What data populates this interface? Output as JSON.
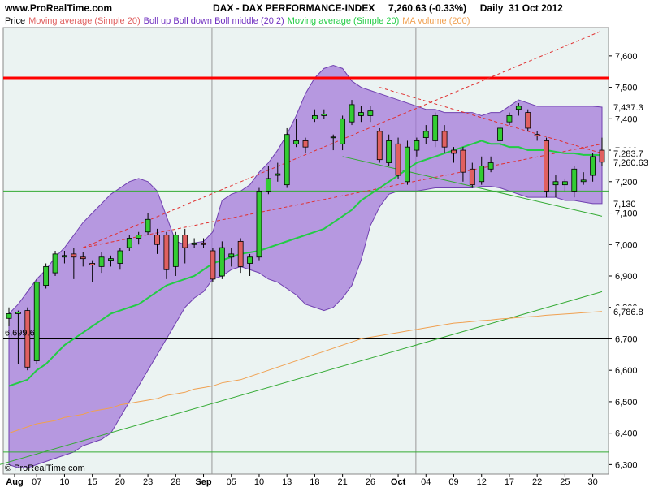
{
  "header": {
    "site": "www.ProRealTime.com",
    "title": "DAX - DAX PERFORMANCE-INDEX     7,260.63 (-0.33%)     Daily  31 Oct 2012"
  },
  "legend": {
    "price": "Price",
    "ma20": "Moving average (Simple 20)",
    "boll": "Boll up Boll down Boll middle (20 2)",
    "ma20_green": "Moving average (Simple 20)",
    "ma200": "MA volume (200)"
  },
  "credit": "© ProRealTime.com",
  "colors": {
    "up": "#33cc33",
    "down": "#e06060",
    "band": "#a070d8",
    "ma20": "#22cc44",
    "ma200": "#f0a050",
    "resistance": "#ff0000",
    "support": "#33aa33"
  },
  "chart_data": {
    "type": "candlestick",
    "y_ticks": [
      "6,300",
      "6,400",
      "6,500",
      "6,600",
      "6,700",
      "6,800",
      "6,900",
      "7,000",
      "7,100",
      "7,200",
      "7,300",
      "7,400",
      "7,500",
      "7,600"
    ],
    "x_ticks": [
      "Aug",
      "07",
      "10",
      "15",
      "20",
      "23",
      "28",
      "Sep",
      "05",
      "10",
      "13",
      "18",
      "21",
      "26",
      "Oct",
      "04",
      "09",
      "12",
      "17",
      "22",
      "25",
      "30"
    ],
    "ylim": [
      6270,
      7690
    ],
    "price_labels": {
      "last": "7,260.63",
      "boll_up": "7,437.3",
      "ma20": "7,283.7",
      "boll_down": "7,130",
      "ma200": "6,786.8",
      "left_level": "6,699.6"
    },
    "horizontal_lines": [
      {
        "value": 7530,
        "kind": "resistance"
      },
      {
        "value": 7170,
        "kind": "support"
      },
      {
        "value": 6700,
        "kind": "level"
      },
      {
        "value": 6340,
        "kind": "support"
      }
    ],
    "candles": [
      {
        "o": 6765,
        "c": 6780,
        "h": 6800,
        "l": 6740
      },
      {
        "o": 6780,
        "c": 6785,
        "h": 6790,
        "l": 6620
      },
      {
        "o": 6790,
        "c": 6610,
        "h": 6800,
        "l": 6600
      },
      {
        "o": 6630,
        "c": 6880,
        "h": 6890,
        "l": 6620
      },
      {
        "o": 6870,
        "c": 6930,
        "h": 6940,
        "l": 6860
      },
      {
        "o": 6910,
        "c": 6970,
        "h": 6980,
        "l": 6900
      },
      {
        "o": 6960,
        "c": 6965,
        "h": 6980,
        "l": 6940
      },
      {
        "o": 6970,
        "c": 6960,
        "h": 6990,
        "l": 6890
      },
      {
        "o": 6960,
        "c": 6955,
        "h": 6975,
        "l": 6930
      },
      {
        "o": 6940,
        "c": 6935,
        "h": 6950,
        "l": 6880
      },
      {
        "o": 6930,
        "c": 6960,
        "h": 6975,
        "l": 6910
      },
      {
        "o": 6950,
        "c": 6955,
        "h": 6965,
        "l": 6930
      },
      {
        "o": 6940,
        "c": 6980,
        "h": 6990,
        "l": 6920
      },
      {
        "o": 6990,
        "c": 7020,
        "h": 7030,
        "l": 6980
      },
      {
        "o": 7020,
        "c": 7030,
        "h": 7040,
        "l": 7000
      },
      {
        "o": 7040,
        "c": 7080,
        "h": 7100,
        "l": 7030
      },
      {
        "o": 7030,
        "c": 7000,
        "h": 7050,
        "l": 6970
      },
      {
        "o": 7030,
        "c": 6920,
        "h": 7040,
        "l": 6890
      },
      {
        "o": 6930,
        "c": 7030,
        "h": 7040,
        "l": 6900
      },
      {
        "o": 7030,
        "c": 6990,
        "h": 7050,
        "l": 6940
      },
      {
        "o": 7000,
        "c": 7005,
        "h": 7020,
        "l": 6990
      },
      {
        "o": 7005,
        "c": 7000,
        "h": 7020,
        "l": 6990
      },
      {
        "o": 6980,
        "c": 6890,
        "h": 6990,
        "l": 6880
      },
      {
        "o": 6900,
        "c": 6990,
        "h": 7010,
        "l": 6890
      },
      {
        "o": 6960,
        "c": 6970,
        "h": 6990,
        "l": 6930
      },
      {
        "o": 7010,
        "c": 6930,
        "h": 7020,
        "l": 6910
      },
      {
        "o": 6940,
        "c": 6960,
        "h": 6970,
        "l": 6900
      },
      {
        "o": 6960,
        "c": 7170,
        "h": 7180,
        "l": 6950
      },
      {
        "o": 7170,
        "c": 7210,
        "h": 7250,
        "l": 7160
      },
      {
        "o": 7220,
        "c": 7225,
        "h": 7260,
        "l": 7200
      },
      {
        "o": 7190,
        "c": 7350,
        "h": 7370,
        "l": 7180
      },
      {
        "o": 7320,
        "c": 7330,
        "h": 7400,
        "l": 7310
      },
      {
        "o": 7330,
        "c": 7310,
        "h": 7340,
        "l": 7290
      },
      {
        "o": 7400,
        "c": 7410,
        "h": 7430,
        "l": 7390
      },
      {
        "o": 7410,
        "c": 7415,
        "h": 7430,
        "l": 7400
      },
      {
        "o": 7340,
        "c": 7342,
        "h": 7350,
        "l": 7300
      },
      {
        "o": 7320,
        "c": 7400,
        "h": 7410,
        "l": 7300
      },
      {
        "o": 7390,
        "c": 7445,
        "h": 7460,
        "l": 7380
      },
      {
        "o": 7410,
        "c": 7420,
        "h": 7440,
        "l": 7390
      },
      {
        "o": 7410,
        "c": 7425,
        "h": 7440,
        "l": 7390
      },
      {
        "o": 7360,
        "c": 7270,
        "h": 7370,
        "l": 7260
      },
      {
        "o": 7260,
        "c": 7330,
        "h": 7350,
        "l": 7250
      },
      {
        "o": 7320,
        "c": 7220,
        "h": 7340,
        "l": 7210
      },
      {
        "o": 7200,
        "c": 7310,
        "h": 7330,
        "l": 7190
      },
      {
        "o": 7300,
        "c": 7330,
        "h": 7340,
        "l": 7280
      },
      {
        "o": 7340,
        "c": 7360,
        "h": 7380,
        "l": 7320
      },
      {
        "o": 7330,
        "c": 7410,
        "h": 7420,
        "l": 7310
      },
      {
        "o": 7360,
        "c": 7310,
        "h": 7380,
        "l": 7290
      },
      {
        "o": 7300,
        "c": 7290,
        "h": 7310,
        "l": 7260
      },
      {
        "o": 7300,
        "c": 7230,
        "h": 7310,
        "l": 7200
      },
      {
        "o": 7240,
        "c": 7190,
        "h": 7260,
        "l": 7180
      },
      {
        "o": 7200,
        "c": 7250,
        "h": 7280,
        "l": 7190
      },
      {
        "o": 7240,
        "c": 7260,
        "h": 7280,
        "l": 7230
      },
      {
        "o": 7330,
        "c": 7370,
        "h": 7380,
        "l": 7310
      },
      {
        "o": 7390,
        "c": 7410,
        "h": 7420,
        "l": 7380
      },
      {
        "o": 7430,
        "c": 7440,
        "h": 7450,
        "l": 7410
      },
      {
        "o": 7420,
        "c": 7370,
        "h": 7430,
        "l": 7360
      },
      {
        "o": 7350,
        "c": 7345,
        "h": 7360,
        "l": 7330
      },
      {
        "o": 7330,
        "c": 7170,
        "h": 7340,
        "l": 7150
      },
      {
        "o": 7190,
        "c": 7200,
        "h": 7220,
        "l": 7150
      },
      {
        "o": 7190,
        "c": 7200,
        "h": 7210,
        "l": 7170
      },
      {
        "o": 7170,
        "c": 7240,
        "h": 7250,
        "l": 7150
      },
      {
        "o": 7200,
        "c": 7205,
        "h": 7230,
        "l": 7190
      },
      {
        "o": 7220,
        "c": 7280,
        "h": 7290,
        "l": 7200
      },
      {
        "o": 7300,
        "c": 7262,
        "h": 7340,
        "l": 7250
      }
    ],
    "boll_upper": [
      6780,
      6810,
      6850,
      6890,
      6920,
      6960,
      6990,
      7030,
      7070,
      7100,
      7130,
      7160,
      7180,
      7200,
      7210,
      7200,
      7170,
      7090,
      7010,
      7000,
      7005,
      7010,
      7040,
      7140,
      7160,
      7170,
      7190,
      7230,
      7260,
      7300,
      7350,
      7410,
      7480,
      7530,
      7560,
      7570,
      7560,
      7520,
      7500,
      7490,
      7480,
      7470,
      7460,
      7450,
      7440,
      7430,
      7430,
      7420,
      7420,
      7420,
      7420,
      7410,
      7420,
      7420,
      7440,
      7460,
      7450,
      7440,
      7440,
      7440,
      7440,
      7440,
      7440,
      7440,
      7437
    ],
    "boll_lower": [
      6300,
      6290,
      6290,
      6300,
      6310,
      6320,
      6330,
      6340,
      6360,
      6370,
      6380,
      6400,
      6450,
      6500,
      6550,
      6600,
      6650,
      6700,
      6750,
      6800,
      6830,
      6850,
      6890,
      6900,
      6920,
      6930,
      6920,
      6910,
      6890,
      6880,
      6860,
      6840,
      6810,
      6800,
      6790,
      6800,
      6830,
      6870,
      6950,
      7060,
      7120,
      7160,
      7170,
      7170,
      7170,
      7175,
      7180,
      7180,
      7180,
      7180,
      7180,
      7185,
      7185,
      7180,
      7170,
      7160,
      7150,
      7150,
      7150,
      7150,
      7140,
      7140,
      7135,
      7130,
      7130
    ],
    "ma20": [
      6550,
      6560,
      6570,
      6600,
      6620,
      6650,
      6680,
      6700,
      6720,
      6740,
      6760,
      6780,
      6790,
      6800,
      6810,
      6830,
      6850,
      6870,
      6880,
      6890,
      6900,
      6920,
      6940,
      6950,
      6960,
      6970,
      6975,
      6980,
      6990,
      7000,
      7010,
      7020,
      7030,
      7040,
      7050,
      7070,
      7090,
      7110,
      7140,
      7160,
      7180,
      7200,
      7220,
      7240,
      7260,
      7270,
      7280,
      7290,
      7300,
      7310,
      7320,
      7330,
      7320,
      7320,
      7310,
      7310,
      7300,
      7300,
      7300,
      7295,
      7290,
      7290,
      7285,
      7285,
      7284
    ],
    "ma200": [
      6400,
      6410,
      6420,
      6430,
      6435,
      6440,
      6450,
      6455,
      6460,
      6470,
      6475,
      6480,
      6490,
      6495,
      6500,
      6505,
      6510,
      6520,
      6525,
      6530,
      6540,
      6545,
      6550,
      6560,
      6565,
      6570,
      6580,
      6590,
      6600,
      6610,
      6620,
      6630,
      6640,
      6650,
      6660,
      6670,
      6680,
      6690,
      6700,
      6705,
      6710,
      6715,
      6720,
      6725,
      6730,
      6735,
      6740,
      6745,
      6750,
      6752,
      6755,
      6758,
      6760,
      6763,
      6765,
      6768,
      6770,
      6772,
      6775,
      6777,
      6779,
      6781,
      6783,
      6785,
      6787
    ]
  }
}
